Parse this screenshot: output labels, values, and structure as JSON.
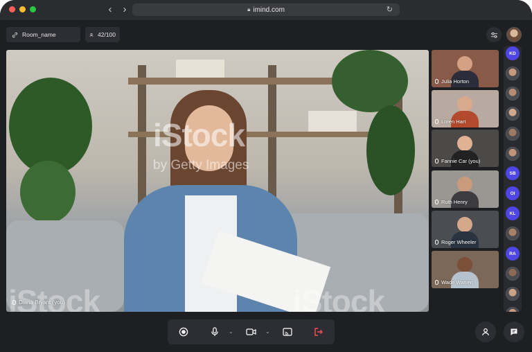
{
  "browser": {
    "url": "imind.com"
  },
  "header": {
    "room_name": "Room_name",
    "participant_count": "42/100"
  },
  "main_video": {
    "speaker": "Diana Bryant (you)",
    "watermark_large": "iStock",
    "watermark_small": "by Getty Images",
    "watermark_bottom": "iStock"
  },
  "tiles": [
    {
      "name": "Julia Horton"
    },
    {
      "name": "Loren Hart"
    },
    {
      "name": "Fannie Car (you)"
    },
    {
      "name": "Ruth Henry"
    },
    {
      "name": "Roger Wheeler"
    },
    {
      "name": "Wade Warren"
    }
  ],
  "sidebar": {
    "avatars": [
      {
        "kind": "initials",
        "text": "KD"
      },
      {
        "kind": "photo"
      },
      {
        "kind": "photo"
      },
      {
        "kind": "photo"
      },
      {
        "kind": "photo"
      },
      {
        "kind": "photo"
      },
      {
        "kind": "initials",
        "text": "SB"
      },
      {
        "kind": "initials",
        "text": "OI"
      },
      {
        "kind": "initials",
        "text": "KL"
      },
      {
        "kind": "photo"
      },
      {
        "kind": "initials",
        "text": "RA"
      },
      {
        "kind": "photo"
      },
      {
        "kind": "photo"
      },
      {
        "kind": "photo"
      }
    ]
  },
  "colors": {
    "accent": "#4f46e5",
    "leave": "#ff4d4f",
    "panel": "#2d2e33",
    "background": "#1e1f22"
  },
  "icons": [
    "record-icon",
    "microphone-icon",
    "camera-icon",
    "screen-share-icon",
    "leave-icon",
    "person-icon",
    "chat-icon",
    "settings-sliders-icon",
    "link-icon",
    "user-icon",
    "lock-icon",
    "reload-icon"
  ]
}
